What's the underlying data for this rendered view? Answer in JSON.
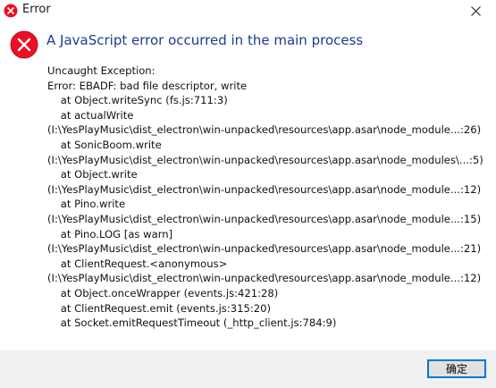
{
  "window": {
    "title": "Error",
    "close_glyph": "✕"
  },
  "dialog": {
    "heading": "A JavaScript error occurred in the main process",
    "message_lines": [
      "Uncaught Exception:",
      "Error: EBADF: bad file descriptor, write",
      "    at Object.writeSync (fs.js:711:3)",
      "    at actualWrite",
      "(I:\\YesPlayMusic\\dist_electron\\win-unpacked\\resources\\app.asar\\node_module...:26)",
      "    at SonicBoom.write",
      "(I:\\YesPlayMusic\\dist_electron\\win-unpacked\\resources\\app.asar\\node_modules\\...:5)",
      "    at Object.write",
      "(I:\\YesPlayMusic\\dist_electron\\win-unpacked\\resources\\app.asar\\node_module...:12)",
      "    at Pino.write",
      "(I:\\YesPlayMusic\\dist_electron\\win-unpacked\\resources\\app.asar\\node_module...:15)",
      "    at Pino.LOG [as warn]",
      "(I:\\YesPlayMusic\\dist_electron\\win-unpacked\\resources\\app.asar\\node_module...:21)",
      "    at ClientRequest.<anonymous>",
      "(I:\\YesPlayMusic\\dist_electron\\win-unpacked\\resources\\app.asar\\node_module...:12)",
      "    at Object.onceWrapper (events.js:421:28)",
      "    at ClientRequest.emit (events.js:315:20)",
      "    at Socket.emitRequestTimeout (_http_client.js:784:9)"
    ],
    "ok_label": "确定"
  },
  "icons": {
    "title_icon": "error-icon",
    "dialog_icon": "error-icon",
    "close_icon": "close-icon"
  },
  "colors": {
    "error_red": "#e81123",
    "heading_blue": "#1a3c8e",
    "accent": "#0078d7",
    "footer_bg": "#f0f0f0"
  }
}
